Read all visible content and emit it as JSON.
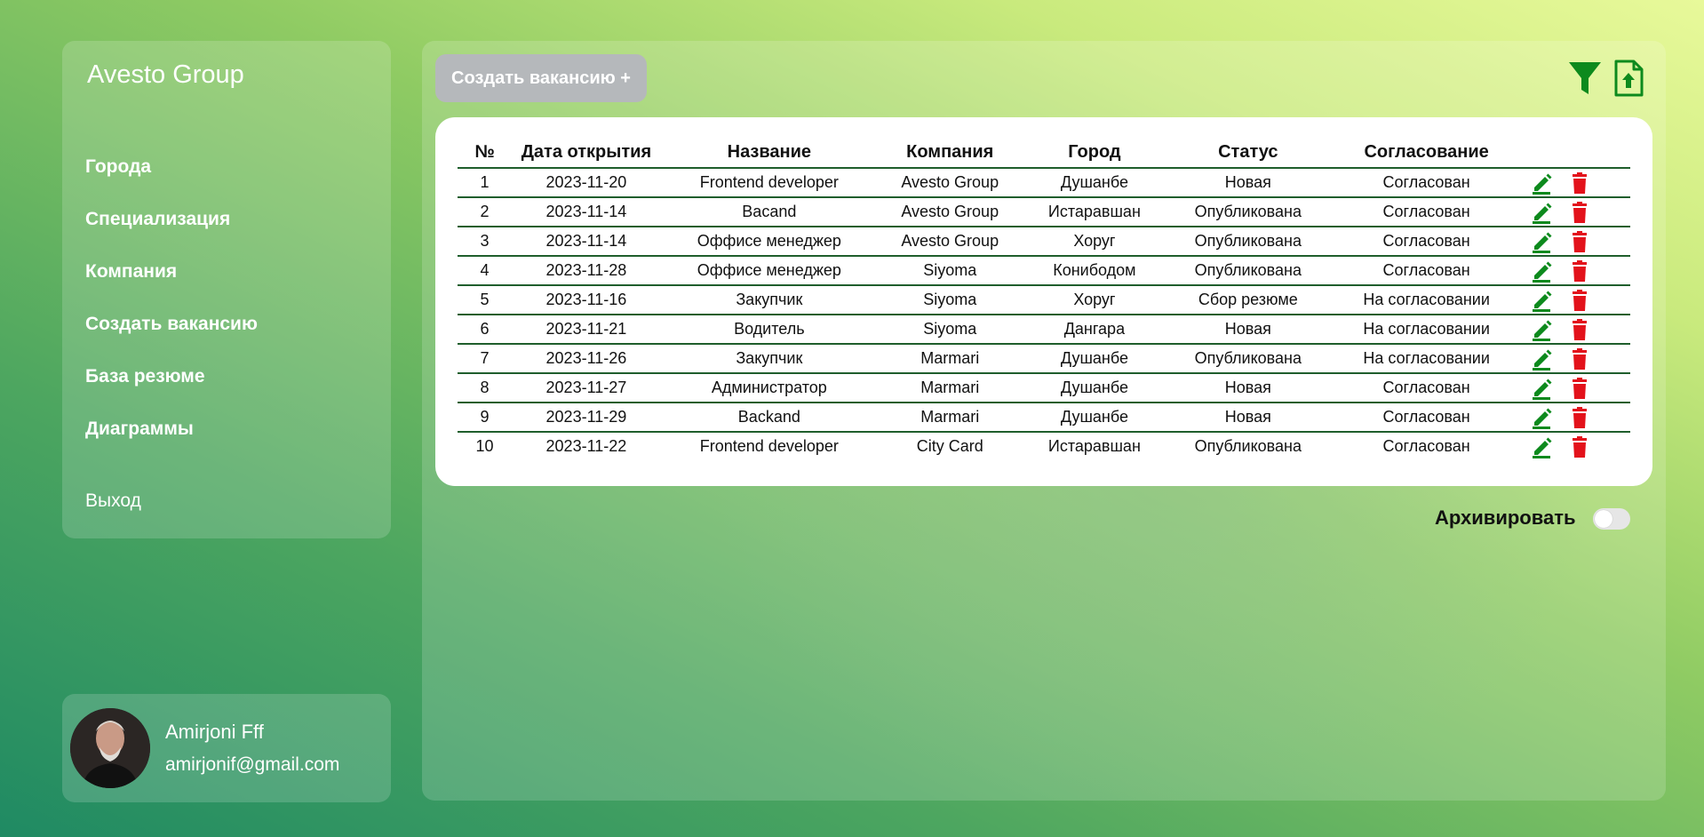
{
  "sidebar": {
    "brand": "Avesto Group",
    "items": [
      {
        "label": "Города"
      },
      {
        "label": "Специализация"
      },
      {
        "label": "Компания"
      },
      {
        "label": "Создать вакансию"
      },
      {
        "label": "База резюме"
      },
      {
        "label": "Диаграммы"
      }
    ],
    "logout_label": "Выход"
  },
  "profile": {
    "name": "Amirjoni Fff",
    "email": "amirjonif@gmail.com"
  },
  "toolbar": {
    "create_label": "Создать вакансию +",
    "filter_icon": "filter-icon",
    "export_icon": "file-upload-icon"
  },
  "table": {
    "headers": [
      "№",
      "Дата открытия",
      "Название",
      "Компания",
      "Город",
      "Статус",
      "Согласование"
    ],
    "rows": [
      {
        "num": "1",
        "date": "2023-11-20",
        "title": "Frontend developer",
        "company": "Avesto Group",
        "city": "Душанбе",
        "status": "Новая",
        "approval": "Согласован"
      },
      {
        "num": "2",
        "date": "2023-11-14",
        "title": "Bacand",
        "company": "Avesto Group",
        "city": "Истаравшан",
        "status": "Опубликована",
        "approval": "Согласован"
      },
      {
        "num": "3",
        "date": "2023-11-14",
        "title": "Оффисе менеджер",
        "company": "Avesto Group",
        "city": "Хоруг",
        "status": "Опубликована",
        "approval": "Согласован"
      },
      {
        "num": "4",
        "date": "2023-11-28",
        "title": "Оффисе менеджер",
        "company": "Siyoma",
        "city": "Конибодом",
        "status": "Опубликована",
        "approval": "Согласован"
      },
      {
        "num": "5",
        "date": "2023-11-16",
        "title": "Закупчик",
        "company": "Siyoma",
        "city": "Хоруг",
        "status": "Сбор резюме",
        "approval": "На согласовании"
      },
      {
        "num": "6",
        "date": "2023-11-21",
        "title": "Водитель",
        "company": "Siyoma",
        "city": "Дангара",
        "status": "Новая",
        "approval": "На согласовании"
      },
      {
        "num": "7",
        "date": "2023-11-26",
        "title": "Закупчик",
        "company": "Marmari",
        "city": "Душанбе",
        "status": "Опубликована",
        "approval": "На согласовании"
      },
      {
        "num": "8",
        "date": "2023-11-27",
        "title": "Администратор",
        "company": "Marmari",
        "city": "Душанбе",
        "status": "Новая",
        "approval": "Согласован"
      },
      {
        "num": "9",
        "date": "2023-11-29",
        "title": "Backand",
        "company": "Marmari",
        "city": "Душанбе",
        "status": "Новая",
        "approval": "Согласован"
      },
      {
        "num": "10",
        "date": "2023-11-22",
        "title": "Frontend developer",
        "company": "City Card",
        "city": "Истаравшан",
        "status": "Опубликована",
        "approval": "Согласован"
      }
    ]
  },
  "archive": {
    "label": "Архивировать",
    "checked": false
  },
  "colors": {
    "accent_green": "#0d8a1d",
    "delete_red": "#e3121b",
    "button_gray": "#b5b8bb"
  }
}
